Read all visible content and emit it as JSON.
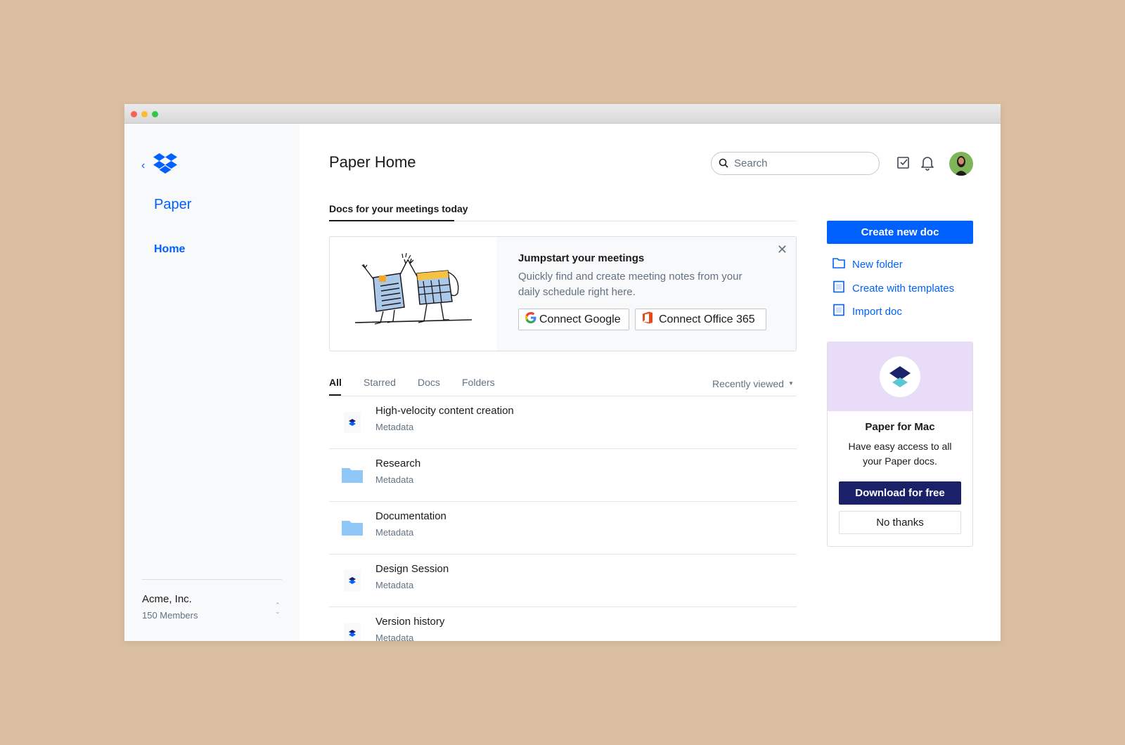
{
  "sidebar": {
    "app_name": "Paper",
    "items": [
      {
        "label": "Home"
      }
    ],
    "team": {
      "name": "Acme, Inc.",
      "members": "150 Members"
    }
  },
  "header": {
    "title": "Paper Home",
    "search": {
      "placeholder": "Search",
      "value": ""
    }
  },
  "meetings": {
    "section_label": "Docs for your meetings today",
    "card": {
      "title": "Jumpstart your meetings",
      "body": "Quickly find and create meeting notes from your daily schedule right here.",
      "connect_google": "Connect Google",
      "connect_office": "Connect Office 365"
    }
  },
  "filters": {
    "tabs": [
      "All",
      "Starred",
      "Docs",
      "Folders"
    ],
    "active": "All",
    "sort": "Recently viewed"
  },
  "files": [
    {
      "name": "High-velocity content creation",
      "meta": "Metadata",
      "type": "doc"
    },
    {
      "name": "Research",
      "meta": "Metadata",
      "type": "folder"
    },
    {
      "name": "Documentation",
      "meta": "Metadata",
      "type": "folder"
    },
    {
      "name": "Design Session",
      "meta": "Metadata",
      "type": "doc"
    },
    {
      "name": "Version history",
      "meta": "Metadata",
      "type": "doc"
    }
  ],
  "actions": {
    "create": "Create new doc",
    "links": [
      "New folder",
      "Create with templates",
      "Import doc"
    ]
  },
  "mac_promo": {
    "title": "Paper for Mac",
    "body": "Have easy access to all your Paper docs.",
    "download": "Download for free",
    "dismiss": "No thanks"
  },
  "colors": {
    "accent": "#0061fe",
    "navy": "#1a2169",
    "background": "#d9bea0",
    "promo_banner": "#e8dcf9",
    "folder": "#8fc7f7"
  },
  "icons": [
    "dropbox-logo-icon",
    "chevron-left-icon",
    "search-icon",
    "checkbox-icon",
    "bell-icon",
    "close-icon",
    "google-icon",
    "office-icon",
    "doc-icon",
    "folder-icon",
    "template-icon",
    "import-icon",
    "paper-logo-icon",
    "chevron-updown-icon",
    "caret-down-icon"
  ]
}
